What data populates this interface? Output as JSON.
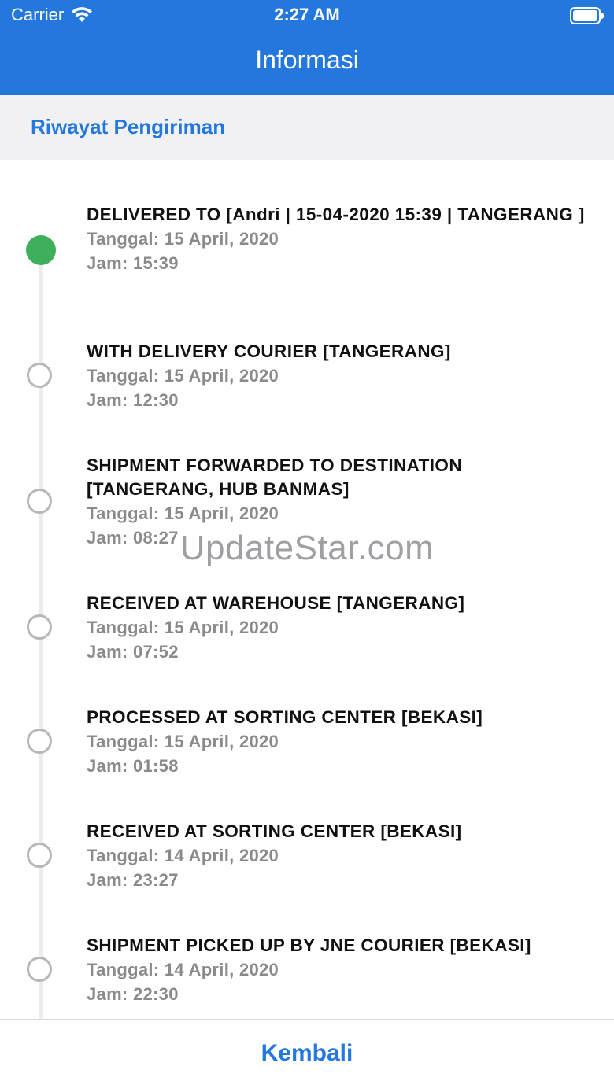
{
  "status_bar": {
    "carrier": "Carrier",
    "time": "2:27 AM"
  },
  "nav": {
    "title": "Informasi"
  },
  "section": {
    "title": "Riwayat Pengiriman"
  },
  "events": [
    {
      "title": "DELIVERED TO [Andri  | 15-04-2020 15:39 | TANGERANG ]",
      "date": "Tanggal: 15 April, 2020",
      "time": "Jam: 15:39",
      "status": "active"
    },
    {
      "title": "WITH DELIVERY COURIER [TANGERANG]",
      "date": "Tanggal: 15 April, 2020",
      "time": "Jam: 12:30",
      "status": "inactive"
    },
    {
      "title": "SHIPMENT FORWARDED TO DESTINATION [TANGERANG, HUB BANMAS]",
      "date": "Tanggal: 15 April, 2020",
      "time": "Jam: 08:27",
      "status": "inactive"
    },
    {
      "title": "RECEIVED AT WAREHOUSE [TANGERANG]",
      "date": "Tanggal: 15 April, 2020",
      "time": "Jam: 07:52",
      "status": "inactive"
    },
    {
      "title": "PROCESSED AT SORTING CENTER [BEKASI]",
      "date": "Tanggal: 15 April, 2020",
      "time": "Jam: 01:58",
      "status": "inactive"
    },
    {
      "title": "RECEIVED AT SORTING CENTER [BEKASI]",
      "date": "Tanggal: 14 April, 2020",
      "time": "Jam: 23:27",
      "status": "inactive"
    },
    {
      "title": "SHIPMENT PICKED UP BY JNE COURIER [BEKASI]",
      "date": "Tanggal: 14 April, 2020",
      "time": "Jam: 22:30",
      "status": "inactive"
    }
  ],
  "watermark": "UpdateStar.com",
  "footer": {
    "back_label": "Kembali"
  },
  "colors": {
    "primary": "#2478DD",
    "active_dot": "#3EAF5A",
    "inactive_dot_border": "#B7B7BA",
    "meta_text": "#8A8A8E",
    "section_bg": "#F1F1F4"
  },
  "icons": {
    "wifi": "wifi-icon",
    "battery": "battery-icon"
  }
}
